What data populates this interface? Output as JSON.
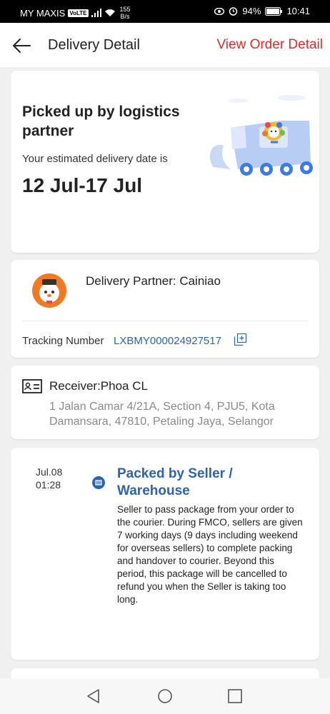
{
  "statusbar": {
    "carrier": "MY MAXIS",
    "volte": "VoLTE",
    "speed_value": "155",
    "speed_unit": "B/s",
    "battery": "94%",
    "time": "10:41"
  },
  "header": {
    "title": "Delivery Detail",
    "view_order": "View Order Detail"
  },
  "status_card": {
    "title": "Picked up by logistics partner",
    "eta_label": "Your estimated delivery date is",
    "eta_date": "12 Jul-17 Jul"
  },
  "partner_card": {
    "partner": "Delivery Partner: Cainiao",
    "tracking_label": "Tracking Number",
    "tracking_number": "LXBMY000024927517"
  },
  "receiver_card": {
    "receiver": "Receiver:Phoa CL",
    "address": "1 Jalan Camar 4/21A, Section 4, PJU5, Kota Damansara, 47810, Petaling Jaya, Selangor"
  },
  "timeline": [
    {
      "date": "Jul.08",
      "time": "01:28",
      "title": "Packed by Seller / Warehouse",
      "description": "Seller to pass package from your order to the courier. During FMCO, sellers are given 7 working days (9 days including weekend for overseas sellers) to complete packing and handover to courier. Beyond this period, this package will be cancelled to refund you when the Seller is taking too long."
    }
  ],
  "colors": {
    "accent_red": "#e5292a",
    "link_blue": "#2a64b0",
    "partner_orange": "#f07a22"
  }
}
